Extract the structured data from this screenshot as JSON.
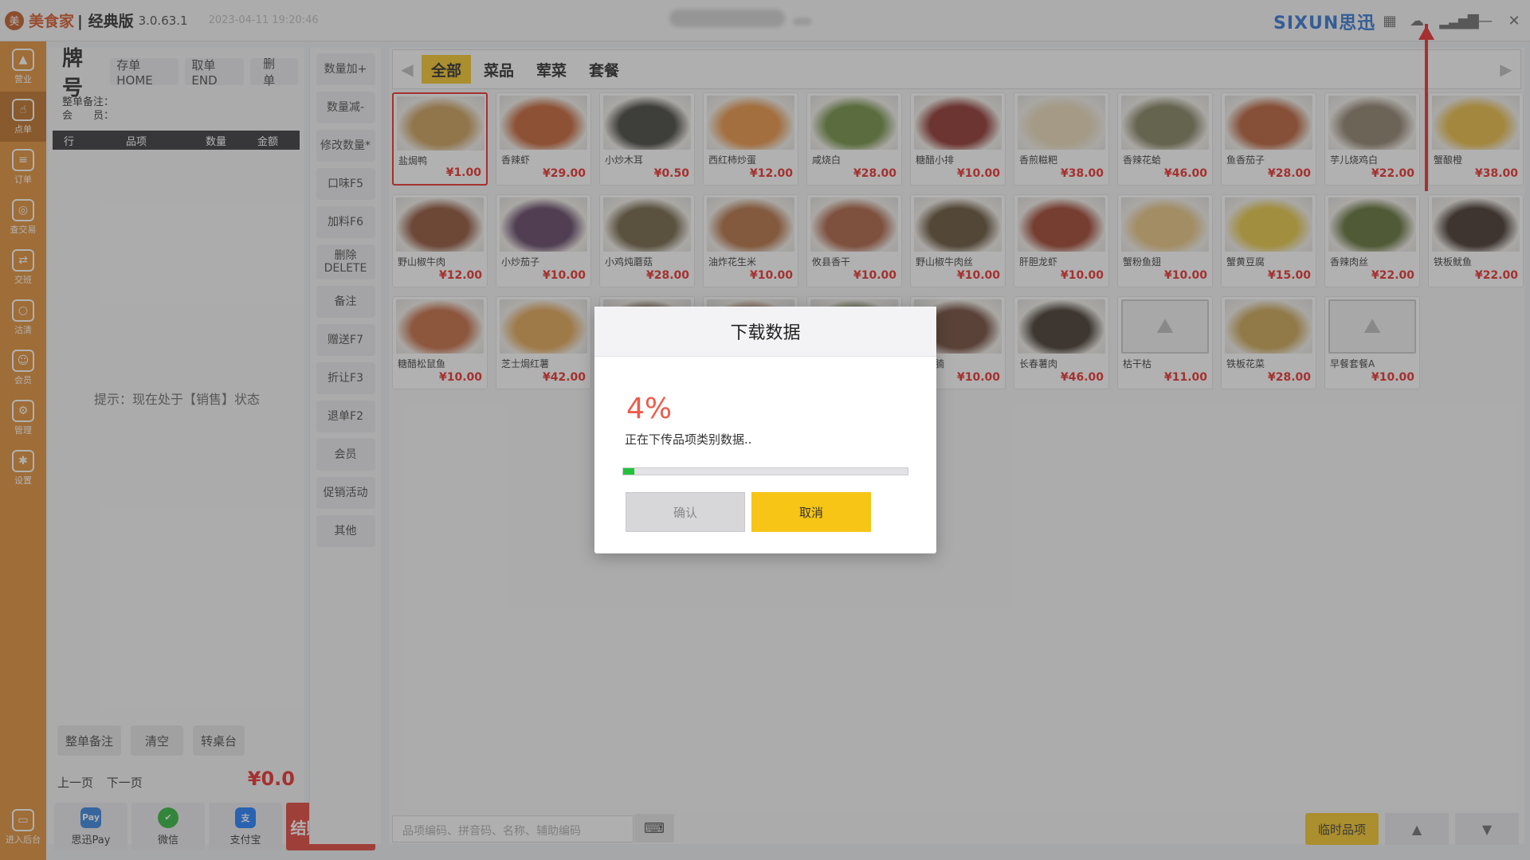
{
  "titlebar": {
    "logo_text": "美",
    "app_name": "美食家",
    "edition": "| 经典版",
    "version": "3.0.63.1",
    "datetime": "2023-04-11 19:20:46",
    "brand": "SIXUN思迅"
  },
  "nav": {
    "items": [
      {
        "label": "营业",
        "icon": "chart-icon"
      },
      {
        "label": "点单",
        "icon": "hand-icon"
      },
      {
        "label": "订单",
        "icon": "document-icon"
      },
      {
        "label": "查交易",
        "icon": "search-icon"
      },
      {
        "label": "交班",
        "icon": "swap-icon"
      },
      {
        "label": "沽清",
        "icon": "clear-icon"
      },
      {
        "label": "会员",
        "icon": "user-icon"
      },
      {
        "label": "管理",
        "icon": "manage-icon"
      },
      {
        "label": "设置",
        "icon": "gear-icon"
      }
    ],
    "bottom": "进入后台"
  },
  "order": {
    "plate_label": "牌号",
    "save_btn": "存单HOME",
    "retrieve_btn": "取单END",
    "delete_btn": "删单",
    "remark_label": "整单备注：",
    "member_label": "会　　员：",
    "columns": [
      "行",
      "品项",
      "数量",
      "金额"
    ],
    "hint": "提示：现在处于【销售】状态",
    "btn_remark": "整单备注",
    "btn_clear": "清空",
    "btn_transfer": "转桌台",
    "prev_page": "上一页",
    "next_page": "下一页",
    "total": "¥0.0",
    "pay": [
      {
        "label": "思迅Pay",
        "icon": "Pay",
        "color": "#2d7fe0"
      },
      {
        "label": "微信",
        "icon": "✔",
        "color": "#27b335"
      },
      {
        "label": "支付宝",
        "icon": "支",
        "color": "#1678ff"
      }
    ],
    "checkout": "结账Enter"
  },
  "functions": [
    "数量加+",
    "数量减-",
    "修改数量*",
    "口味F5",
    "加料F6",
    "删除\nDELETE",
    "备注",
    "赠送F7",
    "折让F3",
    "退单F2",
    "会员",
    "促销活动",
    "其他"
  ],
  "categories": {
    "tabs": [
      "全部",
      "菜品",
      "荤菜",
      "套餐"
    ],
    "active": 0
  },
  "dishes": [
    {
      "name": "盐焗鸭",
      "price": "¥1.00",
      "color": "#c89a52",
      "selected": true
    },
    {
      "name": "香辣虾",
      "price": "¥29.00",
      "color": "#c25a2a"
    },
    {
      "name": "小炒木耳",
      "price": "¥0.50",
      "color": "#3a3a35"
    },
    {
      "name": "西红柿炒蛋",
      "price": "¥12.00",
      "color": "#e88d3c"
    },
    {
      "name": "咸烧白",
      "price": "¥28.00",
      "color": "#6b8a3a"
    },
    {
      "name": "糖醋小排",
      "price": "¥10.00",
      "color": "#8a2a24"
    },
    {
      "name": "香煎糍粑",
      "price": "¥38.00",
      "color": "#e8d7b4"
    },
    {
      "name": "香辣花蛤",
      "price": "¥46.00",
      "color": "#7c7a56"
    },
    {
      "name": "鱼香茄子",
      "price": "¥28.00",
      "color": "#b6572e"
    },
    {
      "name": "芋儿烧鸡白",
      "price": "¥22.00",
      "color": "#8b7a66"
    },
    {
      "name": "蟹酿橙",
      "price": "¥38.00",
      "color": "#e7b73b"
    },
    {
      "name": "野山椒牛肉",
      "price": "¥12.00",
      "color": "#8a4a2e"
    },
    {
      "name": "小炒茄子",
      "price": "¥10.00",
      "color": "#5a3a5e"
    },
    {
      "name": "小鸡炖蘑菇",
      "price": "¥28.00",
      "color": "#6a5a3a"
    },
    {
      "name": "油炸花生米",
      "price": "¥10.00",
      "color": "#b06a3a"
    },
    {
      "name": "攸县香干",
      "price": "¥10.00",
      "color": "#a85a3a"
    },
    {
      "name": "野山椒牛肉丝",
      "price": "¥10.00",
      "color": "#5e4a2e"
    },
    {
      "name": "肝胆龙虾",
      "price": "¥10.00",
      "color": "#9a3a24"
    },
    {
      "name": "蟹粉鱼翅",
      "price": "¥10.00",
      "color": "#e6c17a"
    },
    {
      "name": "蟹黄豆腐",
      "price": "¥15.00",
      "color": "#e3c43c"
    },
    {
      "name": "香辣肉丝",
      "price": "¥22.00",
      "color": "#5a6a2e"
    },
    {
      "name": "铁板鱿鱼",
      "price": "¥22.00",
      "color": "#3a2a22"
    },
    {
      "name": "糖醋松鼠鱼",
      "price": "¥10.00",
      "color": "#c2643a"
    },
    {
      "name": "芝士焗红薯",
      "price": "¥42.00",
      "color": "#e0a04c"
    },
    {
      "name": "",
      "price": "",
      "color": "#6a4a3a"
    },
    {
      "name": "",
      "price": "",
      "color": "#9a6a4a"
    },
    {
      "name": "",
      "price": "",
      "color": "#5a6a3a"
    },
    {
      "name": "烧牛腩",
      "price": "¥10.00",
      "color": "#6a4030"
    },
    {
      "name": "长春薯肉",
      "price": "¥46.00",
      "color": "#3a2e24"
    },
    {
      "name": "枯干枯",
      "price": "¥11.00",
      "color": "",
      "placeholder": true
    },
    {
      "name": "铁板花菜",
      "price": "¥28.00",
      "color": "#c8a04a"
    },
    {
      "name": "早餐套餐A",
      "price": "¥10.00",
      "color": "",
      "placeholder": true
    }
  ],
  "search": {
    "placeholder": "品项编码、拼音码、名称、辅助编码"
  },
  "temp_item": "临时品项",
  "modal": {
    "title": "下载数据",
    "percent": "4%",
    "progress": 0.04,
    "status": "正在下传品项类别数据..",
    "confirm": "确认",
    "cancel": "取消"
  }
}
